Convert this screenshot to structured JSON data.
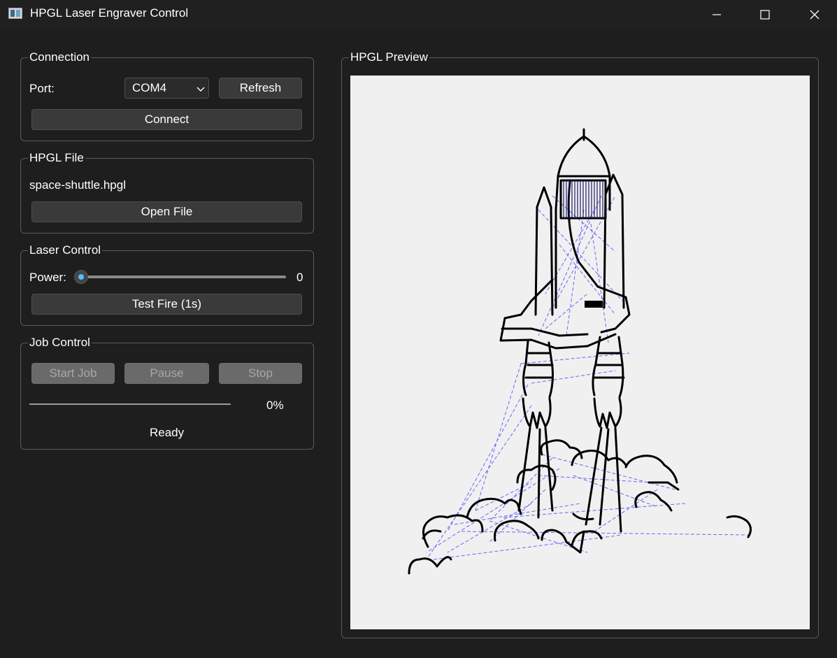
{
  "window": {
    "title": "HPGL Laser Engraver Control"
  },
  "connection": {
    "legend": "Connection",
    "port_label": "Port:",
    "port_value": "COM4",
    "refresh_label": "Refresh",
    "connect_label": "Connect"
  },
  "file": {
    "legend": "HPGL File",
    "filename": "space-shuttle.hpgl",
    "open_label": "Open File"
  },
  "laser": {
    "legend": "Laser Control",
    "power_label": "Power:",
    "power_value": "0",
    "power_level": 0,
    "test_fire_label": "Test Fire (1s)"
  },
  "job": {
    "legend": "Job Control",
    "start_label": "Start Job",
    "pause_label": "Pause",
    "stop_label": "Stop",
    "progress_text": "0%",
    "progress_fraction": 0,
    "status": "Ready"
  },
  "preview": {
    "legend": "HPGL Preview"
  },
  "colors": {
    "accent": "#4cc2ff",
    "draw_stroke": "#000000",
    "travel_stroke": "#3a3aff"
  }
}
